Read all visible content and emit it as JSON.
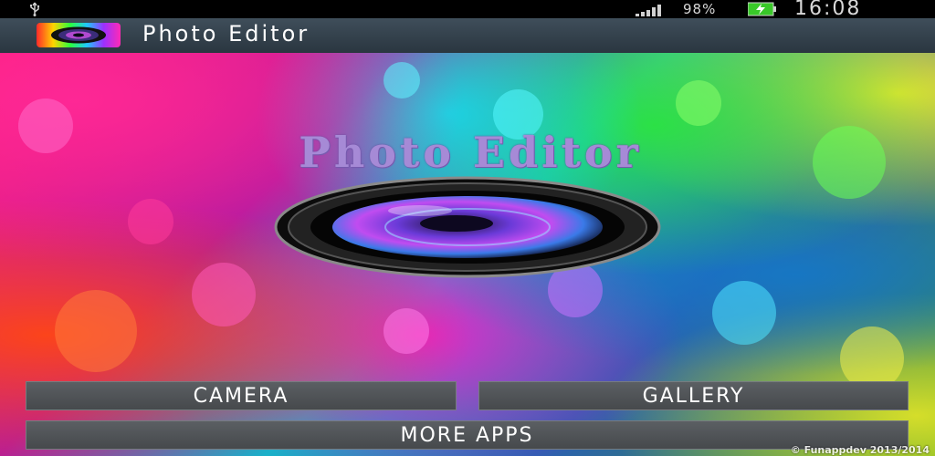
{
  "status_bar": {
    "battery_percent": "98%",
    "time": "16:08",
    "icons": [
      "usb-icon",
      "signal-icon",
      "battery-charging-icon"
    ],
    "battery_color": "#39c829"
  },
  "action_bar": {
    "title": "Photo Editor",
    "icon": "app-camera-lens-icon"
  },
  "main": {
    "hero_title": "Photo Editor",
    "lens_icon": "camera-lens-icon",
    "buttons": {
      "camera": "CAMERA",
      "gallery": "GALLERY",
      "more_apps": "MORE APPS"
    },
    "copyright": "© Funappdev 2013/2014"
  },
  "colors": {
    "action_bar": "#34424d",
    "button": "#505458",
    "hero_title": "#a68ad6"
  }
}
